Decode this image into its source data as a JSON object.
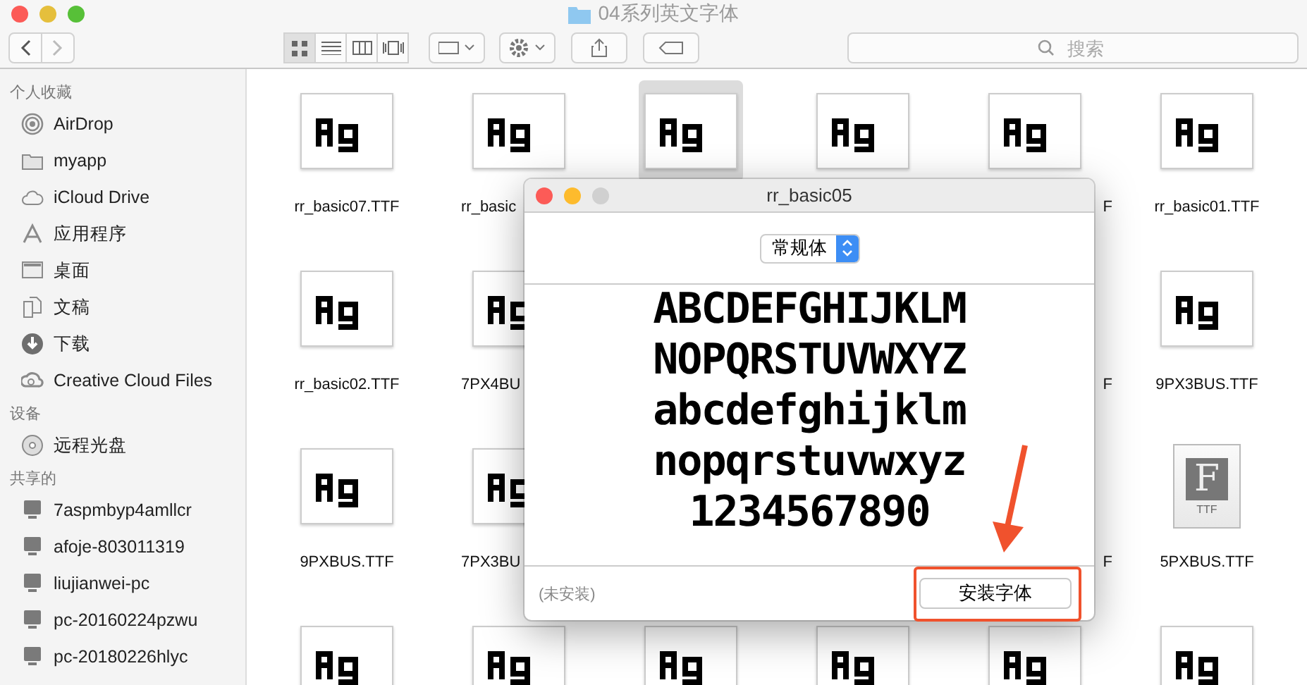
{
  "window": {
    "title": "04系列英文字体"
  },
  "toolbar": {
    "views": [
      {
        "kind": "icons",
        "selected": true
      },
      {
        "kind": "list",
        "selected": false
      },
      {
        "kind": "columns",
        "selected": false
      },
      {
        "kind": "gallery",
        "selected": false
      }
    ],
    "search": {
      "placeholder": "搜索"
    }
  },
  "sidebar": {
    "sections": [
      {
        "heading": "个人收藏",
        "items": [
          {
            "kind": "airdrop",
            "label": "AirDrop"
          },
          {
            "kind": "folder",
            "label": "myapp"
          },
          {
            "kind": "cloud",
            "label": "iCloud Drive"
          },
          {
            "kind": "apps",
            "label": "应用程序"
          },
          {
            "kind": "desktop",
            "label": "桌面"
          },
          {
            "kind": "documents",
            "label": "文稿"
          },
          {
            "kind": "download",
            "label": "下载"
          },
          {
            "kind": "creative-cloud",
            "label": "Creative Cloud Files"
          }
        ]
      },
      {
        "heading": "设备",
        "items": [
          {
            "kind": "disc",
            "label": "远程光盘"
          }
        ]
      },
      {
        "heading": "共享的",
        "items": [
          {
            "kind": "computer",
            "label": "7aspmbyp4amllcr"
          },
          {
            "kind": "computer",
            "label": "afoje-803011319"
          },
          {
            "kind": "computer",
            "label": "liujianwei-pc"
          },
          {
            "kind": "computer",
            "label": "pc-20160224pzwu"
          },
          {
            "kind": "computer",
            "label": "pc-20180226hlyc"
          }
        ]
      }
    ]
  },
  "files": [
    [
      {
        "kind": "font",
        "selected": false,
        "label": "rr_basic07.TTF"
      },
      {
        "kind": "font",
        "selected": false,
        "label": "rr_basic"
      },
      {
        "kind": "font",
        "selected": true
      },
      {
        "kind": "font",
        "selected": false
      },
      {
        "kind": "font",
        "selected": false,
        "label": "F"
      },
      {
        "kind": "font",
        "selected": false,
        "label": "rr_basic01.TTF"
      }
    ],
    [
      {
        "kind": "font",
        "selected": false,
        "label": "rr_basic02.TTF"
      },
      {
        "kind": "font",
        "selected": false,
        "label": "7PX4BU"
      },
      {
        "kind": "hidden"
      },
      {
        "kind": "hidden"
      },
      {
        "kind": "hidden",
        "label": "F"
      },
      {
        "kind": "font",
        "selected": false,
        "label": "9PX3BUS.TTF"
      }
    ],
    [
      {
        "kind": "font",
        "selected": false,
        "label": "9PXBUS.TTF"
      },
      {
        "kind": "font",
        "selected": false,
        "label": "7PX3BU"
      },
      {
        "kind": "hidden"
      },
      {
        "kind": "hidden"
      },
      {
        "kind": "hidden",
        "label": "F"
      },
      {
        "kind": "document",
        "selected": false,
        "label": "5PXBUS.TTF",
        "icon_letter": "F",
        "icon_caption": "TTF"
      }
    ],
    [
      {
        "kind": "font",
        "selected": false
      },
      {
        "kind": "font",
        "selected": false
      },
      {
        "kind": "font",
        "selected": false
      },
      {
        "kind": "font",
        "selected": false
      },
      {
        "kind": "font",
        "selected": false
      },
      {
        "kind": "font",
        "selected": false
      }
    ]
  ],
  "dialog": {
    "title": "rr_basic05",
    "style_popup": "常规体",
    "preview_lines": [
      "ABCDEFGHIJKLM",
      "NOPQRSTUVWXYZ",
      "abcdefghijklm",
      "nopqrstuvwxyz",
      "1234567890"
    ],
    "status": "(未安装)",
    "install_button": "安装字体"
  },
  "annotation": {
    "highlight": true,
    "arrow": true
  }
}
